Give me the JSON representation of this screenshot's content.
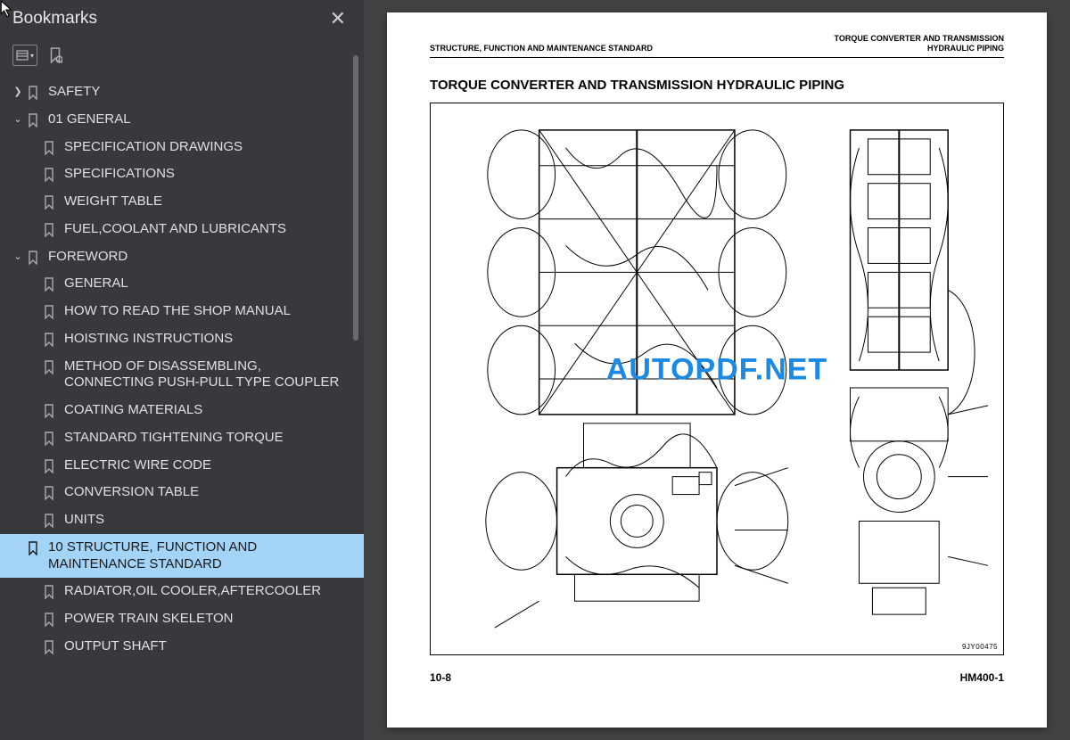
{
  "sidebar": {
    "title": "Bookmarks",
    "tree": [
      {
        "label": "SAFETY",
        "caret": "right",
        "depth": 0
      },
      {
        "label": "01 GENERAL",
        "caret": "down",
        "depth": 0
      },
      {
        "label": "SPECIFICATION DRAWINGS",
        "caret": "",
        "depth": 1
      },
      {
        "label": "SPECIFICATIONS",
        "caret": "",
        "depth": 1
      },
      {
        "label": "WEIGHT TABLE",
        "caret": "",
        "depth": 1
      },
      {
        "label": "FUEL,COOLANT AND LUBRICANTS",
        "caret": "",
        "depth": 1
      },
      {
        "label": "FOREWORD",
        "caret": "down",
        "depth": 0
      },
      {
        "label": "GENERAL",
        "caret": "",
        "depth": 1
      },
      {
        "label": "HOW TO READ THE SHOP MANUAL",
        "caret": "",
        "depth": 1
      },
      {
        "label": "HOISTING INSTRUCTIONS",
        "caret": "",
        "depth": 1
      },
      {
        "label": "METHOD OF DISASSEMBLING, CONNECTING PUSH-PULL TYPE COUPLER",
        "caret": "",
        "depth": 1
      },
      {
        "label": "COATING MATERIALS",
        "caret": "",
        "depth": 1
      },
      {
        "label": "STANDARD TIGHTENING TORQUE",
        "caret": "",
        "depth": 1
      },
      {
        "label": "ELECTRIC WIRE CODE",
        "caret": "",
        "depth": 1
      },
      {
        "label": "CONVERSION TABLE",
        "caret": "",
        "depth": 1
      },
      {
        "label": "UNITS",
        "caret": "",
        "depth": 1
      },
      {
        "label": "10 STRUCTURE, FUNCTION AND MAINTENANCE STANDARD",
        "caret": "down",
        "depth": 0,
        "selected": true
      },
      {
        "label": "RADIATOR,OIL COOLER,AFTERCOOLER",
        "caret": "",
        "depth": 1
      },
      {
        "label": "POWER TRAIN SKELETON",
        "caret": "",
        "depth": 1
      },
      {
        "label": "OUTPUT SHAFT",
        "caret": "",
        "depth": 1
      }
    ]
  },
  "page": {
    "header_left": "STRUCTURE, FUNCTION AND MAINTENANCE STANDARD",
    "header_right_1": "TORQUE CONVERTER AND TRANSMISSION",
    "header_right_2": "HYDRAULIC PIPING",
    "title": "TORQUE CONVERTER AND TRANSMISSION HYDRAULIC PIPING",
    "footer_left": "10-8",
    "footer_right": "HM400-1",
    "diagram_code": "9JY00475"
  },
  "watermark": "AUTOPDF.NET"
}
